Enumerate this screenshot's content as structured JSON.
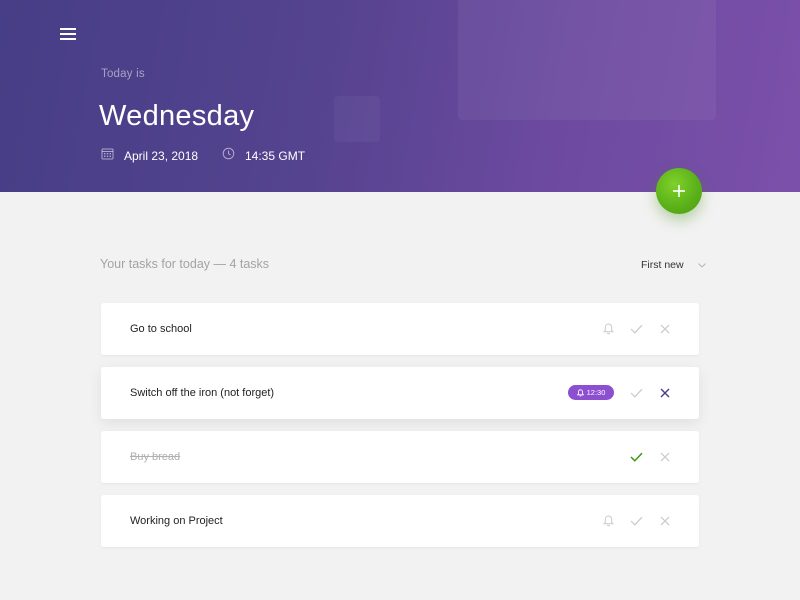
{
  "header": {
    "today_label": "Today is",
    "day": "Wednesday",
    "date": "April 23, 2018",
    "time": "14:35 GMT"
  },
  "tasks_heading": "Your tasks for today — 4 tasks",
  "sort": {
    "selected": "First new"
  },
  "tasks": [
    {
      "text": "Go to school",
      "state": "pending"
    },
    {
      "text": "Switch off the iron (not forget)",
      "state": "pending",
      "reminder": "12:30"
    },
    {
      "text": "Buy bread",
      "state": "done"
    },
    {
      "text": "Working on Project",
      "state": "pending"
    }
  ],
  "colors": {
    "header_gradient_start": "#463e86",
    "header_gradient_end": "#7b50aa",
    "add_button": "#5cb21a",
    "reminder_badge": "#8c4fd0",
    "done_check": "#3f9a12",
    "active_close": "#4a3d8f",
    "background": "#f2f2f2"
  },
  "icons": {
    "menu": "hamburger-icon",
    "date": "calendar-icon",
    "time": "clock-icon",
    "add": "plus-icon",
    "sort": "chevron-down-icon",
    "reminder": "bell-icon",
    "complete": "check-icon",
    "delete": "close-icon"
  }
}
